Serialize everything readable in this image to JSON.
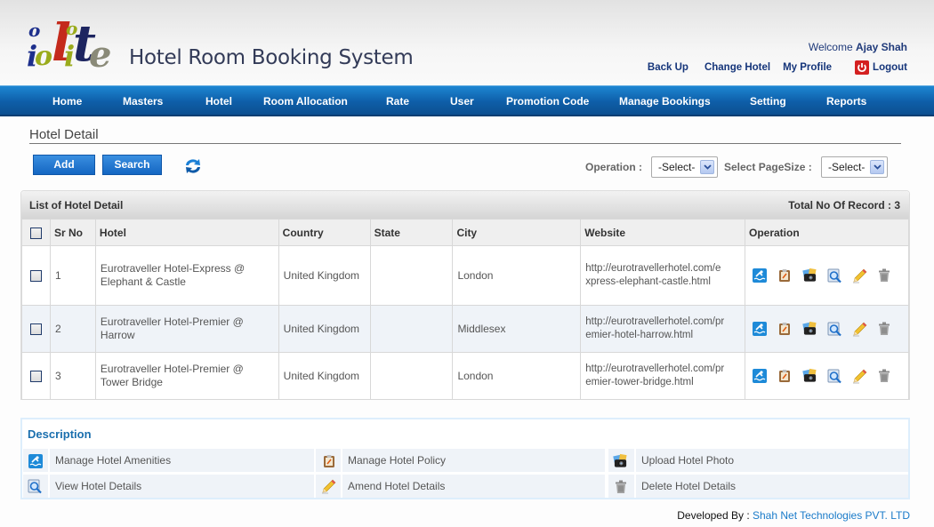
{
  "app": {
    "logo_text": "iolite",
    "title": "Hotel Room Booking System"
  },
  "user": {
    "welcome_prefix": "Welcome",
    "name": "Ajay Shah"
  },
  "top_links": {
    "backup": "Back Up",
    "change_hotel": "Change Hotel",
    "my_profile": "My Profile",
    "logout": "Logout"
  },
  "nav": [
    {
      "label": "Home"
    },
    {
      "label": "Masters"
    },
    {
      "label": "Hotel"
    },
    {
      "label": "Room Allocation"
    },
    {
      "label": "Rate"
    },
    {
      "label": "User"
    },
    {
      "label": "Promotion Code"
    },
    {
      "label": "Manage Bookings"
    },
    {
      "label": "Setting"
    },
    {
      "label": "Reports"
    }
  ],
  "page": {
    "title": "Hotel Detail",
    "add_label": "Add",
    "search_label": "Search",
    "operation_label": "Operation :",
    "operation_value": "-Select-",
    "pagesize_label": "Select PageSize :",
    "pagesize_value": "-Select-"
  },
  "list": {
    "title": "List of Hotel  Detail",
    "total": "Total No Of Record : 3",
    "columns": [
      "Sr No",
      "Hotel",
      "Country",
      "State",
      "City",
      "Website",
      "Operation"
    ],
    "rows": [
      {
        "sr": "1",
        "hotel": "Eurotraveller Hotel-Express @ Elephant & Castle",
        "country": "United Kingdom",
        "state": "",
        "city": "London",
        "website": "http://eurotravellerhotel.com/express-elephant-castle.html"
      },
      {
        "sr": "2",
        "hotel": "Eurotraveller Hotel-Premier @ Harrow",
        "country": "United Kingdom",
        "state": "",
        "city": "Middlesex",
        "website": "http://eurotravellerhotel.com/premier-hotel-harrow.html"
      },
      {
        "sr": "3",
        "hotel": "Eurotraveller Hotel-Premier @ Tower Bridge",
        "country": "United Kingdom",
        "state": "",
        "city": "London",
        "website": "http://eurotravellerhotel.com/premier-tower-bridge.html"
      }
    ],
    "operation_icons": [
      "amenities-icon",
      "policy-icon",
      "photo-icon",
      "view-icon",
      "edit-icon",
      "delete-icon"
    ]
  },
  "description": {
    "title": "Description",
    "items": [
      {
        "icon": "amenities-icon",
        "label": "Manage Hotel Amenities"
      },
      {
        "icon": "policy-icon",
        "label": "Manage Hotel Policy"
      },
      {
        "icon": "photo-icon",
        "label": "Upload Hotel Photo"
      },
      {
        "icon": "view-icon",
        "label": "View Hotel Details"
      },
      {
        "icon": "edit-icon",
        "label": "Amend Hotel Details"
      },
      {
        "icon": "delete-icon",
        "label": "Delete Hotel Details"
      }
    ]
  },
  "footer": {
    "prefix": "Developed By :",
    "company": "Shah Net Technologies PVT. LTD"
  },
  "colors": {
    "nav_blue": "#0e5ea8",
    "link_blue": "#15357a",
    "desc_title": "#1a6fae",
    "alt_row": "#eff3f8"
  }
}
